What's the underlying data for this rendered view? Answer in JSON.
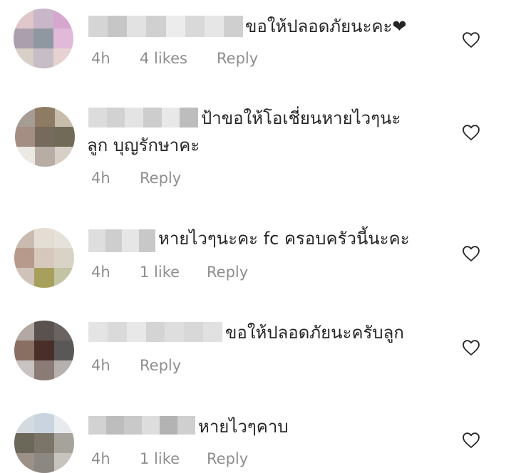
{
  "comments": [
    {
      "text": "ขอให้ปลอดภัยนะคะ❤",
      "time": "4h",
      "likes": "4 likes",
      "reply": "Reply",
      "avatar_colors": [
        "#e0c7c9",
        "#c9b6c9",
        "#d7a6cf",
        "#ab9fae",
        "#8f98a1",
        "#e1b9d9",
        "#d8cfc7",
        "#c7bdc6",
        "#e6d3d1"
      ],
      "username_colors": [
        "#d5d5d5",
        "#c6c6c6",
        "#e2e2e2",
        "#d0d0d0",
        "#ececec",
        "#d9d9d9",
        "#e6e6e6",
        "#cfcfcf"
      ]
    },
    {
      "text": "ป้าขอให้โอเชี่ยนหายไวๆนะ\nลูก บุญรักษาคะ",
      "time": "4h",
      "likes": "",
      "reply": "Reply",
      "avatar_colors": [
        "#a59d94",
        "#8e7b63",
        "#c8bcab",
        "#a48d83",
        "#756a5c",
        "#6f6b57",
        "#ece8e2",
        "#b7ada5",
        "#d6d0c7"
      ],
      "username_colors": [
        "#dcdcdc",
        "#d2d2d2",
        "#e4e4e4",
        "#cdcdcd",
        "#e8e8e8",
        "#bdbdbd"
      ]
    },
    {
      "text": "หายไวๆนะคะ fc ครอบครัวนี้นะคะ",
      "time": "4h",
      "likes": "1 like",
      "reply": "Reply",
      "avatar_colors": [
        "#c9bbb0",
        "#e4ddd4",
        "#e6e2db",
        "#b79a8c",
        "#d6c8bc",
        "#d9d3c6",
        "#cfc3b9",
        "#a7a05c",
        "#c2c4a4"
      ],
      "username_colors": [
        "#dedede",
        "#cecece",
        "#e6e6e6",
        "#c8c8c8"
      ]
    },
    {
      "text": "ขอให้ปลอดภัยนะครับลูก",
      "time": "4h",
      "likes": "",
      "reply": "Reply",
      "avatar_colors": [
        "#b4a8a4",
        "#5a524f",
        "#6b6361",
        "#896e62",
        "#4a2e2a",
        "#5a5757",
        "#c9c3c1",
        "#8a7b77",
        "#b5b0ae"
      ],
      "username_colors": [
        "#e4e4e4",
        "#dadada",
        "#e8e8e8",
        "#d4d4d4",
        "#dedede",
        "#d8d8d8",
        "#e1e1e1"
      ]
    },
    {
      "text": "หายไวๆคาบ",
      "time": "4h",
      "likes": "1 like",
      "reply": "Reply",
      "avatar_colors": [
        "#d3dbe1",
        "#c9d4de",
        "#e7ebee",
        "#6b6759",
        "#7a7568",
        "#a6a39a",
        "#9b9188",
        "#8d8782",
        "#c7c3bd"
      ],
      "username_colors": [
        "#d2d2d2",
        "#bdbdbd",
        "#c9c9c9",
        "#dddddd",
        "#b3b3b3",
        "#cfcfcf"
      ]
    }
  ]
}
